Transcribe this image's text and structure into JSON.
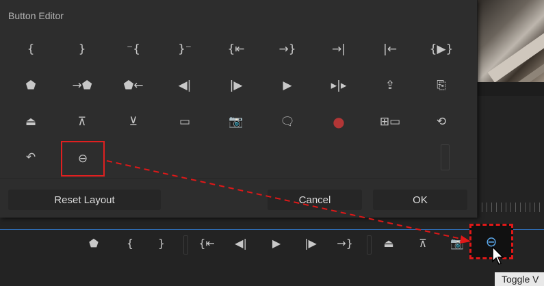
{
  "dialog": {
    "title": "Button Editor",
    "buttons": [
      {
        "icon": "mark-in-icon",
        "glyph": "{"
      },
      {
        "icon": "mark-out-icon",
        "glyph": "}"
      },
      {
        "icon": "clear-in-icon",
        "glyph": "⁻{"
      },
      {
        "icon": "clear-out-icon",
        "glyph": "}⁻"
      },
      {
        "icon": "go-to-in-icon",
        "glyph": "{⇤"
      },
      {
        "icon": "go-to-out-icon",
        "glyph": "→}"
      },
      {
        "icon": "go-to-next-edit-icon",
        "glyph": "→|"
      },
      {
        "icon": "go-to-previous-edit-icon",
        "glyph": "|←"
      },
      {
        "icon": "play-in-to-out-icon",
        "glyph": "{▶}"
      },
      {
        "icon": "add-marker-icon",
        "glyph": "⬟"
      },
      {
        "icon": "go-to-next-marker-icon",
        "glyph": "→⬟"
      },
      {
        "icon": "go-to-previous-marker-icon",
        "glyph": "⬟←"
      },
      {
        "icon": "step-back-icon",
        "glyph": "◀|"
      },
      {
        "icon": "step-forward-icon",
        "glyph": "|▶"
      },
      {
        "icon": "play-stop-icon",
        "glyph": "▶"
      },
      {
        "icon": "shuttle-icon",
        "glyph": "▸|▸"
      },
      {
        "icon": "export-frame-icon",
        "glyph": "⇪"
      },
      {
        "icon": "overwrite-icon",
        "glyph": "⎘"
      },
      {
        "icon": "lift-icon",
        "glyph": "⏏"
      },
      {
        "icon": "extract-icon",
        "glyph": "⊼"
      },
      {
        "icon": "trim-icon",
        "glyph": "⊻"
      },
      {
        "icon": "safe-margins-icon",
        "glyph": "▭"
      },
      {
        "icon": "camera-icon",
        "glyph": "📷"
      },
      {
        "icon": "comment-icon",
        "glyph": "🗨"
      },
      {
        "icon": "record-icon",
        "glyph": "●"
      },
      {
        "icon": "multi-camera-icon",
        "glyph": "⊞▭"
      },
      {
        "icon": "proxy-toggle-icon",
        "glyph": "⟲"
      },
      {
        "icon": "undo-icon",
        "glyph": "↶"
      },
      {
        "icon": "toggle-vr-icon",
        "glyph": "⊖"
      }
    ],
    "reset_label": "Reset Layout",
    "cancel_label": "Cancel",
    "ok_label": "OK"
  },
  "toolbar": {
    "items": [
      {
        "icon": "add-marker-icon",
        "glyph": "⬟"
      },
      {
        "icon": "mark-in-icon",
        "glyph": "{"
      },
      {
        "icon": "mark-out-icon",
        "glyph": "}"
      },
      {
        "icon": "go-to-in-icon",
        "glyph": "{⇤"
      },
      {
        "icon": "step-back-icon",
        "glyph": "◀|"
      },
      {
        "icon": "play-stop-icon",
        "glyph": "▶"
      },
      {
        "icon": "step-forward-icon",
        "glyph": "|▶"
      },
      {
        "icon": "go-to-out-icon",
        "glyph": "→}"
      },
      {
        "icon": "lift-icon",
        "glyph": "⏏"
      },
      {
        "icon": "extract-icon",
        "glyph": "⊼"
      },
      {
        "icon": "camera-icon",
        "glyph": "📷"
      },
      {
        "icon": "toggle-vr-icon",
        "glyph": "⊖"
      }
    ],
    "tooltip": "Toggle V"
  },
  "colors": {
    "highlight": "#e02020",
    "active_icon": "#5aa6e8",
    "record": "#b23636"
  }
}
